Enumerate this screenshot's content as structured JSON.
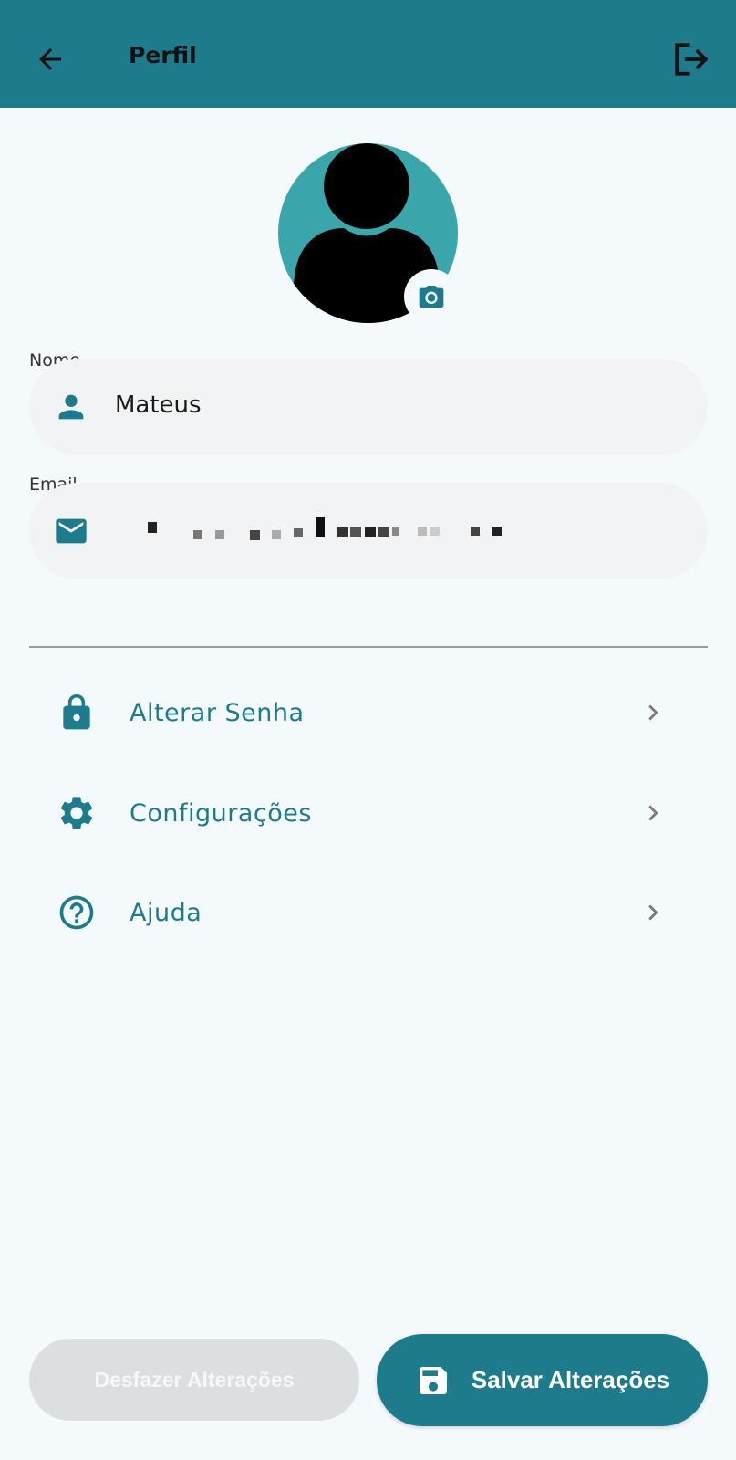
{
  "header": {
    "title": "Perfil",
    "back_icon": "arrow-left-icon",
    "logout_icon": "logout-icon",
    "background": "#1e7b8c"
  },
  "profile": {
    "avatar_icon": "person-avatar-icon",
    "camera_icon": "camera-icon",
    "avatar_bg": "#3aa6ac"
  },
  "fields": {
    "name": {
      "label": "Nome",
      "value": "Mateus",
      "icon": "person-icon"
    },
    "email": {
      "label": "Email",
      "icon": "mail-icon"
    }
  },
  "menu": [
    {
      "label": "Alterar Senha",
      "icon": "lock-icon"
    },
    {
      "label": "Configurações",
      "icon": "gear-icon"
    },
    {
      "label": "Ajuda",
      "icon": "help-circle-icon"
    }
  ],
  "actions": {
    "undo_label": "Desfazer Alterações",
    "save_label": "Salvar Alterações",
    "save_icon": "save-icon"
  },
  "colors": {
    "accent": "#1e7b8c",
    "background": "#f4f9fc",
    "field_bg": "#f1f3f4",
    "disabled_button": "#dcdfe1"
  }
}
